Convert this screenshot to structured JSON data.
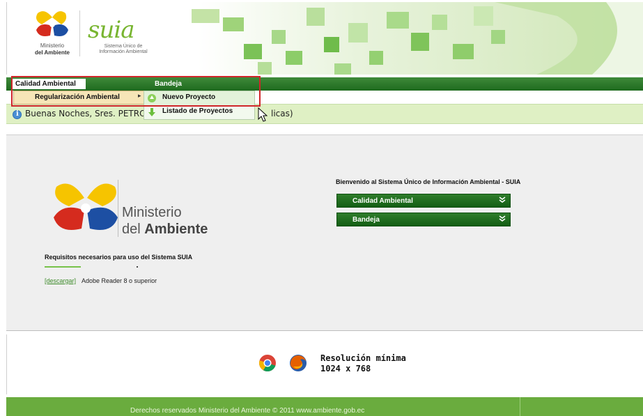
{
  "header": {
    "ministry_logo_line1": "Ministerio",
    "ministry_logo_line2": "del Ambiente",
    "suia_logo_word": "suia",
    "suia_subtitle_line1": "Sistema Único de",
    "suia_subtitle_line2": "Información Ambiental"
  },
  "menubar": {
    "calidad_label": "Calidad Ambiental",
    "bandeja_label": "Bandeja"
  },
  "dropdown": {
    "regularizacion_label": "Regularización Ambiental",
    "nuevo_proyecto_label": "Nuevo Proyecto",
    "listado_proyectos_label": "Listado de Proyectos"
  },
  "greeting": {
    "text": "Buenas Noches, Sres. PETRO",
    "tail": "licas)"
  },
  "main": {
    "logo_line1": "Ministerio",
    "logo_line2_prefix": "del ",
    "logo_line2_bold": "Ambiente",
    "requirements_title": "Requisitos necesarios para uso del Sistema SUIA",
    "download_link": "[descargar]",
    "download_text": "Adobe Reader 8 o superior",
    "welcome_text": "Bienvenido al Sistema Único de Información Ambiental - SUIA",
    "accordion": [
      {
        "label": "Calidad Ambiental"
      },
      {
        "label": "Bandeja"
      }
    ]
  },
  "info": {
    "resolution_label": "Resolución mínima",
    "resolution_value": "1024 x 768"
  },
  "footer": {
    "text": "Derechos reservados Ministerio del Ambiente © 2011 www.ambiente.gob.ec"
  },
  "colors": {
    "menubar_green": "#1e6a1e",
    "greeting_bg": "#dff0c4",
    "footer_green": "#6aac3e",
    "highlight_red": "#d0262a",
    "submenu_hover": "#f6e5b7"
  }
}
